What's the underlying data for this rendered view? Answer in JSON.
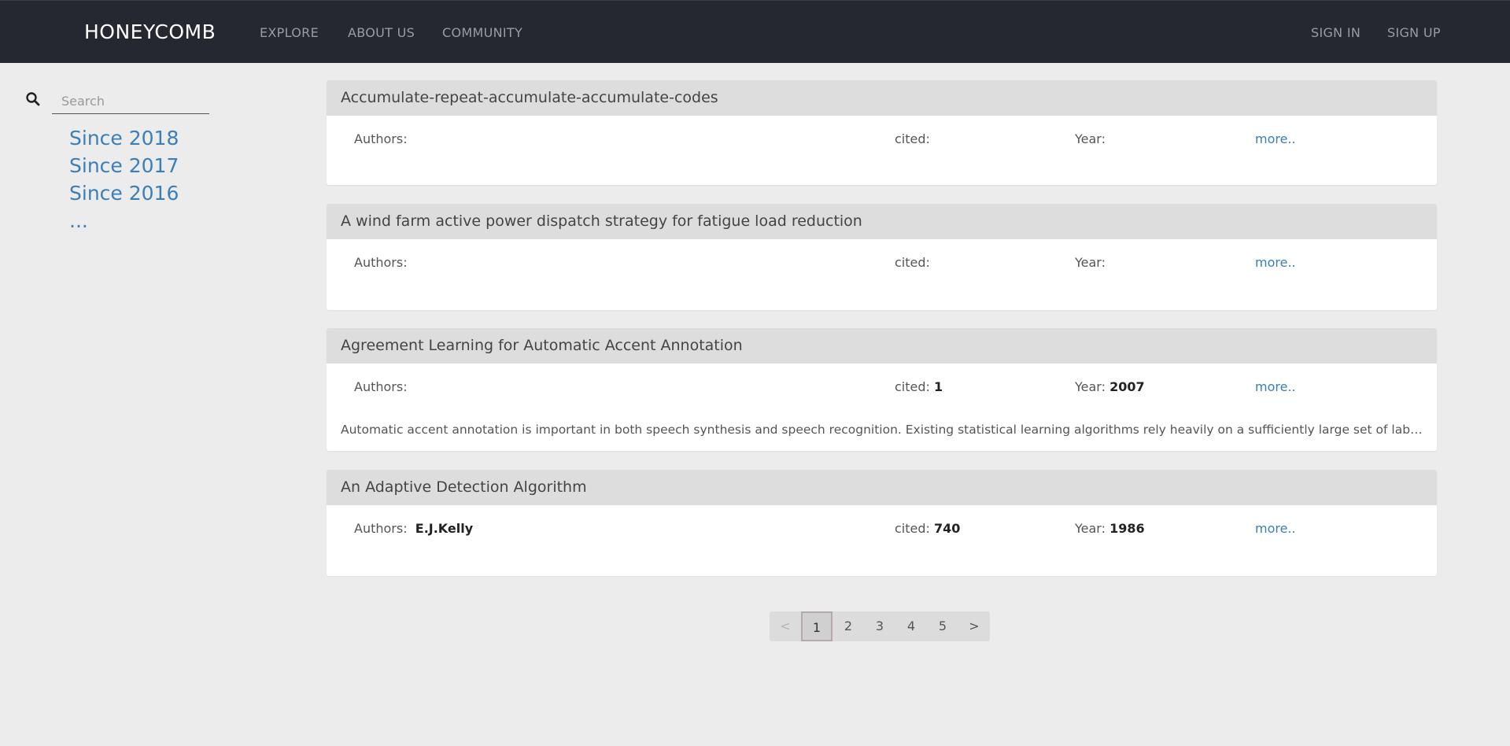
{
  "header": {
    "brand": "HONEYCOMB",
    "nav": [
      "EXPLORE",
      "ABOUT US",
      "COMMUNITY"
    ],
    "auth": [
      "SIGN IN",
      "SIGN UP"
    ]
  },
  "sidebar": {
    "search_placeholder": "Search",
    "filters": [
      "Since 2018",
      "Since 2017",
      "Since 2016",
      "..."
    ]
  },
  "labels": {
    "authors": "Authors:",
    "cited": "cited:",
    "year": "Year:",
    "more": "more.."
  },
  "papers": [
    {
      "title": "Accumulate-repeat-accumulate-accumulate-codes",
      "authors": "",
      "cited": "",
      "year": "",
      "abstract": ""
    },
    {
      "title": "A wind farm active power dispatch strategy for fatigue load reduction",
      "authors": "",
      "cited": "",
      "year": "",
      "abstract": ""
    },
    {
      "title": "Agreement Learning for Automatic Accent Annotation",
      "authors": "",
      "cited": "1",
      "year": "2007",
      "abstract": "Automatic accent annotation is important in both speech synthesis and speech recognition. Existing statistical learning algorithms rely heavily on a sufficiently large set of labeled ..."
    },
    {
      "title": "An Adaptive Detection Algorithm",
      "authors": "E.J.Kelly",
      "cited": "740",
      "year": "1986",
      "abstract": ""
    }
  ],
  "pagination": {
    "prev": "<",
    "pages": [
      "1",
      "2",
      "3",
      "4",
      "5"
    ],
    "next": ">",
    "current": "1"
  },
  "colors": {
    "navbar": "#252830",
    "background": "#ececec",
    "card_header": "#dddddd",
    "link": "#3a7fb8"
  }
}
